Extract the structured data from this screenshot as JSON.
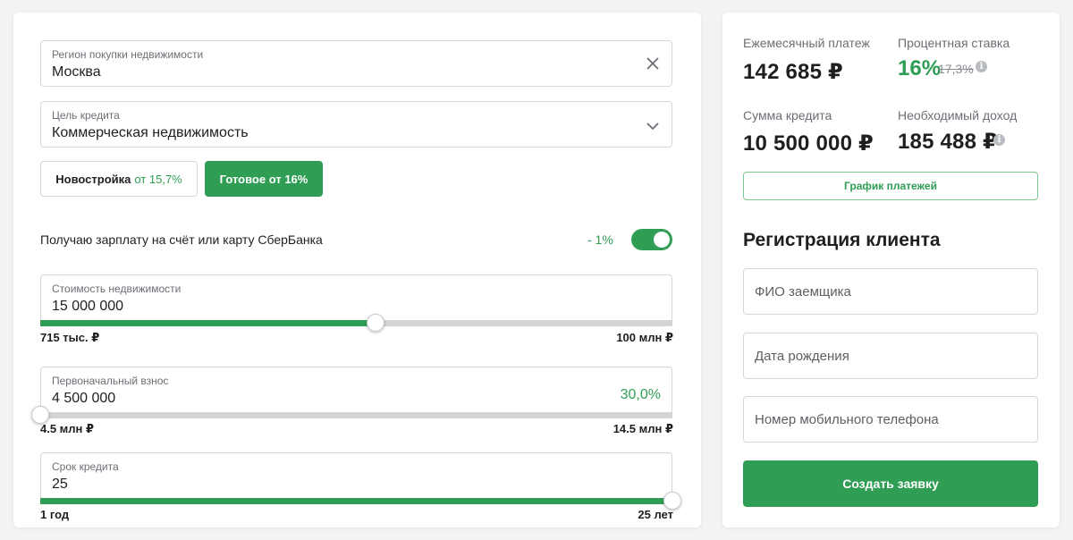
{
  "calculator": {
    "region": {
      "label": "Регион покупки недвижимости",
      "value": "Москва"
    },
    "purpose": {
      "label": "Цель кредита",
      "value": "Коммерческая недвижимость"
    },
    "property_type": {
      "new_label": "Новостройка",
      "new_rate": "от 15,7%",
      "ready_label": "Готовое от 16%",
      "selected": "ready"
    },
    "salary": {
      "label": "Получаю зарплату на счёт или карту СберБанка",
      "discount": "- 1%",
      "enabled": true
    },
    "property_cost": {
      "label": "Стоимость недвижимости",
      "value": "15 000 000",
      "min_label": "715 тыс. ₽",
      "max_label": "100 млн ₽",
      "level": 0.53
    },
    "down_payment": {
      "label": "Первоначальный взнос",
      "value": "4 500 000",
      "percent": "30,0%",
      "min_label": "4.5 млн ₽",
      "max_label": "14.5 млн ₽",
      "level": 0.0
    },
    "term": {
      "label": "Срок кредита",
      "value": "25",
      "min_label": "1 год",
      "max_label": "25 лет",
      "level": 1.0
    }
  },
  "summary": {
    "monthly_label": "Ежемесячный платеж",
    "monthly_value": "142 685 ₽",
    "rate_label": "Процентная ставка",
    "rate_value": "16%",
    "rate_old": "17,3%",
    "loan_label": "Сумма кредита",
    "loan_value": "10 500 000 ₽",
    "income_label": "Необходимый доход",
    "income_value": "185 488 ₽",
    "schedule_button": "График платежей"
  },
  "registration": {
    "title": "Регистрация клиента",
    "name_placeholder": "ФИО заемщика",
    "birth_placeholder": "Дата рождения",
    "phone_placeholder": "Номер мобильного телефона",
    "submit_label": "Создать заявку"
  },
  "colors": {
    "accent": "#2f9e54",
    "border": "#d6d8dc",
    "track": "#d3d4d6"
  },
  "icons": {
    "clear": "close-icon",
    "dropdown": "chevron-down-icon",
    "info": "info-icon"
  }
}
